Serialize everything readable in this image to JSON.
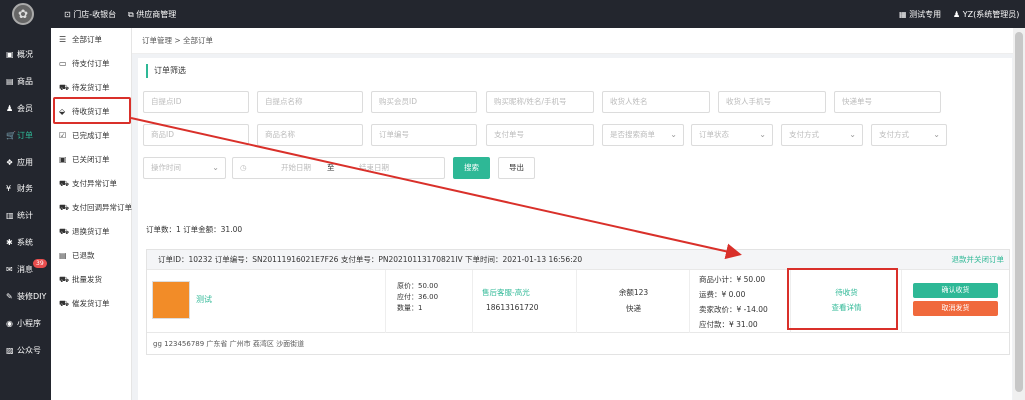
{
  "topbar": {
    "logo_glyph": "✿",
    "nav1_icon": "⊡",
    "nav1_label": "门店-收银台",
    "nav2_icon": "⧉",
    "nav2_label": "供应商管理",
    "test_icon": "▦",
    "test_label": "测试专用",
    "user_icon": "♟",
    "user_label": "YZ(系统管理员)"
  },
  "sidebar": {
    "items": [
      {
        "icon": "▣",
        "label": "概况"
      },
      {
        "icon": "▤",
        "label": "商品"
      },
      {
        "icon": "♟",
        "label": "会员"
      },
      {
        "icon": "🛒",
        "label": "订单"
      },
      {
        "icon": "❖",
        "label": "应用"
      },
      {
        "icon": "¥",
        "label": "财务"
      },
      {
        "icon": "▥",
        "label": "统计"
      },
      {
        "icon": "✱",
        "label": "系统"
      },
      {
        "icon": "✉",
        "label": "消息"
      },
      {
        "icon": "✎",
        "label": "装修DIY"
      },
      {
        "icon": "◉",
        "label": "小程序"
      },
      {
        "icon": "▨",
        "label": "公众号"
      }
    ],
    "message_badge": "39",
    "active_color": "#2eb896"
  },
  "subnav": {
    "items": [
      {
        "icon": "☰",
        "label": "全部订单"
      },
      {
        "icon": "▭",
        "label": "待支付订单"
      },
      {
        "icon": "⛟",
        "label": "待发货订单"
      },
      {
        "icon": "⬙",
        "label": "待收货订单"
      },
      {
        "icon": "☑",
        "label": "已完成订单"
      },
      {
        "icon": "▣",
        "label": "已关闭订单"
      },
      {
        "icon": "⛟",
        "label": "支付异常订单"
      },
      {
        "icon": "⛟",
        "label": "支付回调异常订单"
      },
      {
        "icon": "⛟",
        "label": "退换货订单"
      },
      {
        "icon": "▤",
        "label": "已退款"
      },
      {
        "icon": "⛟",
        "label": "批量发货"
      },
      {
        "icon": "⛟",
        "label": "催发货订单"
      }
    ]
  },
  "breadcrumb": "订单管理 > 全部订单",
  "filter": {
    "title": "订单筛选",
    "row1": [
      "自提点ID",
      "自提点名称",
      "购买会员ID",
      "购买昵称/姓名/手机号",
      "收货人姓名",
      "收货人手机号",
      "快递单号"
    ],
    "row2_inputs": [
      "商品ID",
      "商品名称",
      "订单编号",
      "支付单号"
    ],
    "row2_selects": [
      "是否搜索商单",
      "订单状态",
      "支付方式",
      "支付方式"
    ],
    "time_select": "操作时间",
    "start_date": "开始日期",
    "sep": "至",
    "end_date": "结束日期",
    "search_button": "搜索",
    "export_button": "导出",
    "accent": "#2eb896"
  },
  "summary": "订单数：1    订单金额：31.00",
  "order": {
    "head": "订单ID：10232    订单编号：SN20111916021E7F26    支付单号：PN20210113170821IV    下单时间：2021-01-13 16:56:20",
    "head_link": "退款并关闭订单",
    "product_name": "测试",
    "price_lines": [
      "原价：50.00",
      "应付：36.00",
      "数量：1"
    ],
    "staff_name": "售后客服-高光",
    "staff_phone": "18613161720",
    "balance": "余额123",
    "express": "快递",
    "amount_lines": [
      "商品小计：¥ 50.00",
      "运费：¥ 0.00",
      "卖家改价：¥ -14.00",
      "应付款：¥ 31.00"
    ],
    "status": "待收货",
    "detail_link": "查看详情",
    "confirm_button": "确认收货",
    "cancel_button": "取消发货",
    "confirm_color": "#2eb896",
    "cancel_color": "#f0693c",
    "footer": "gg    123456789    广东省 广州市 荔湾区 沙面街道"
  }
}
